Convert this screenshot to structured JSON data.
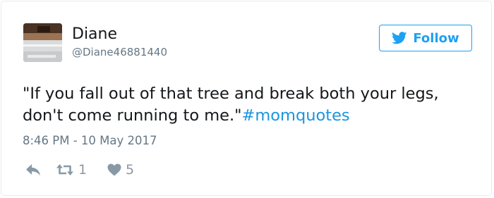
{
  "user": {
    "display_name": "Diane",
    "handle": "@Diane46881440"
  },
  "follow_button": {
    "label": "Follow",
    "icon": "twitter-bird-icon"
  },
  "tweet": {
    "text": "\"If you fall out of that tree and break both your legs, don't come running to me.\"",
    "hashtag": "#momquotes",
    "timestamp": "8:46 PM - 10 May 2017"
  },
  "actions": {
    "reply_icon": "reply-icon",
    "retweet_icon": "retweet-icon",
    "retweet_count": "1",
    "like_icon": "heart-icon",
    "like_count": "5"
  },
  "colors": {
    "accent": "#1da1f2",
    "hashtag": "#1b95e0",
    "text": "#14171a",
    "secondary": "#657786",
    "action_gray": "#8899a6"
  }
}
